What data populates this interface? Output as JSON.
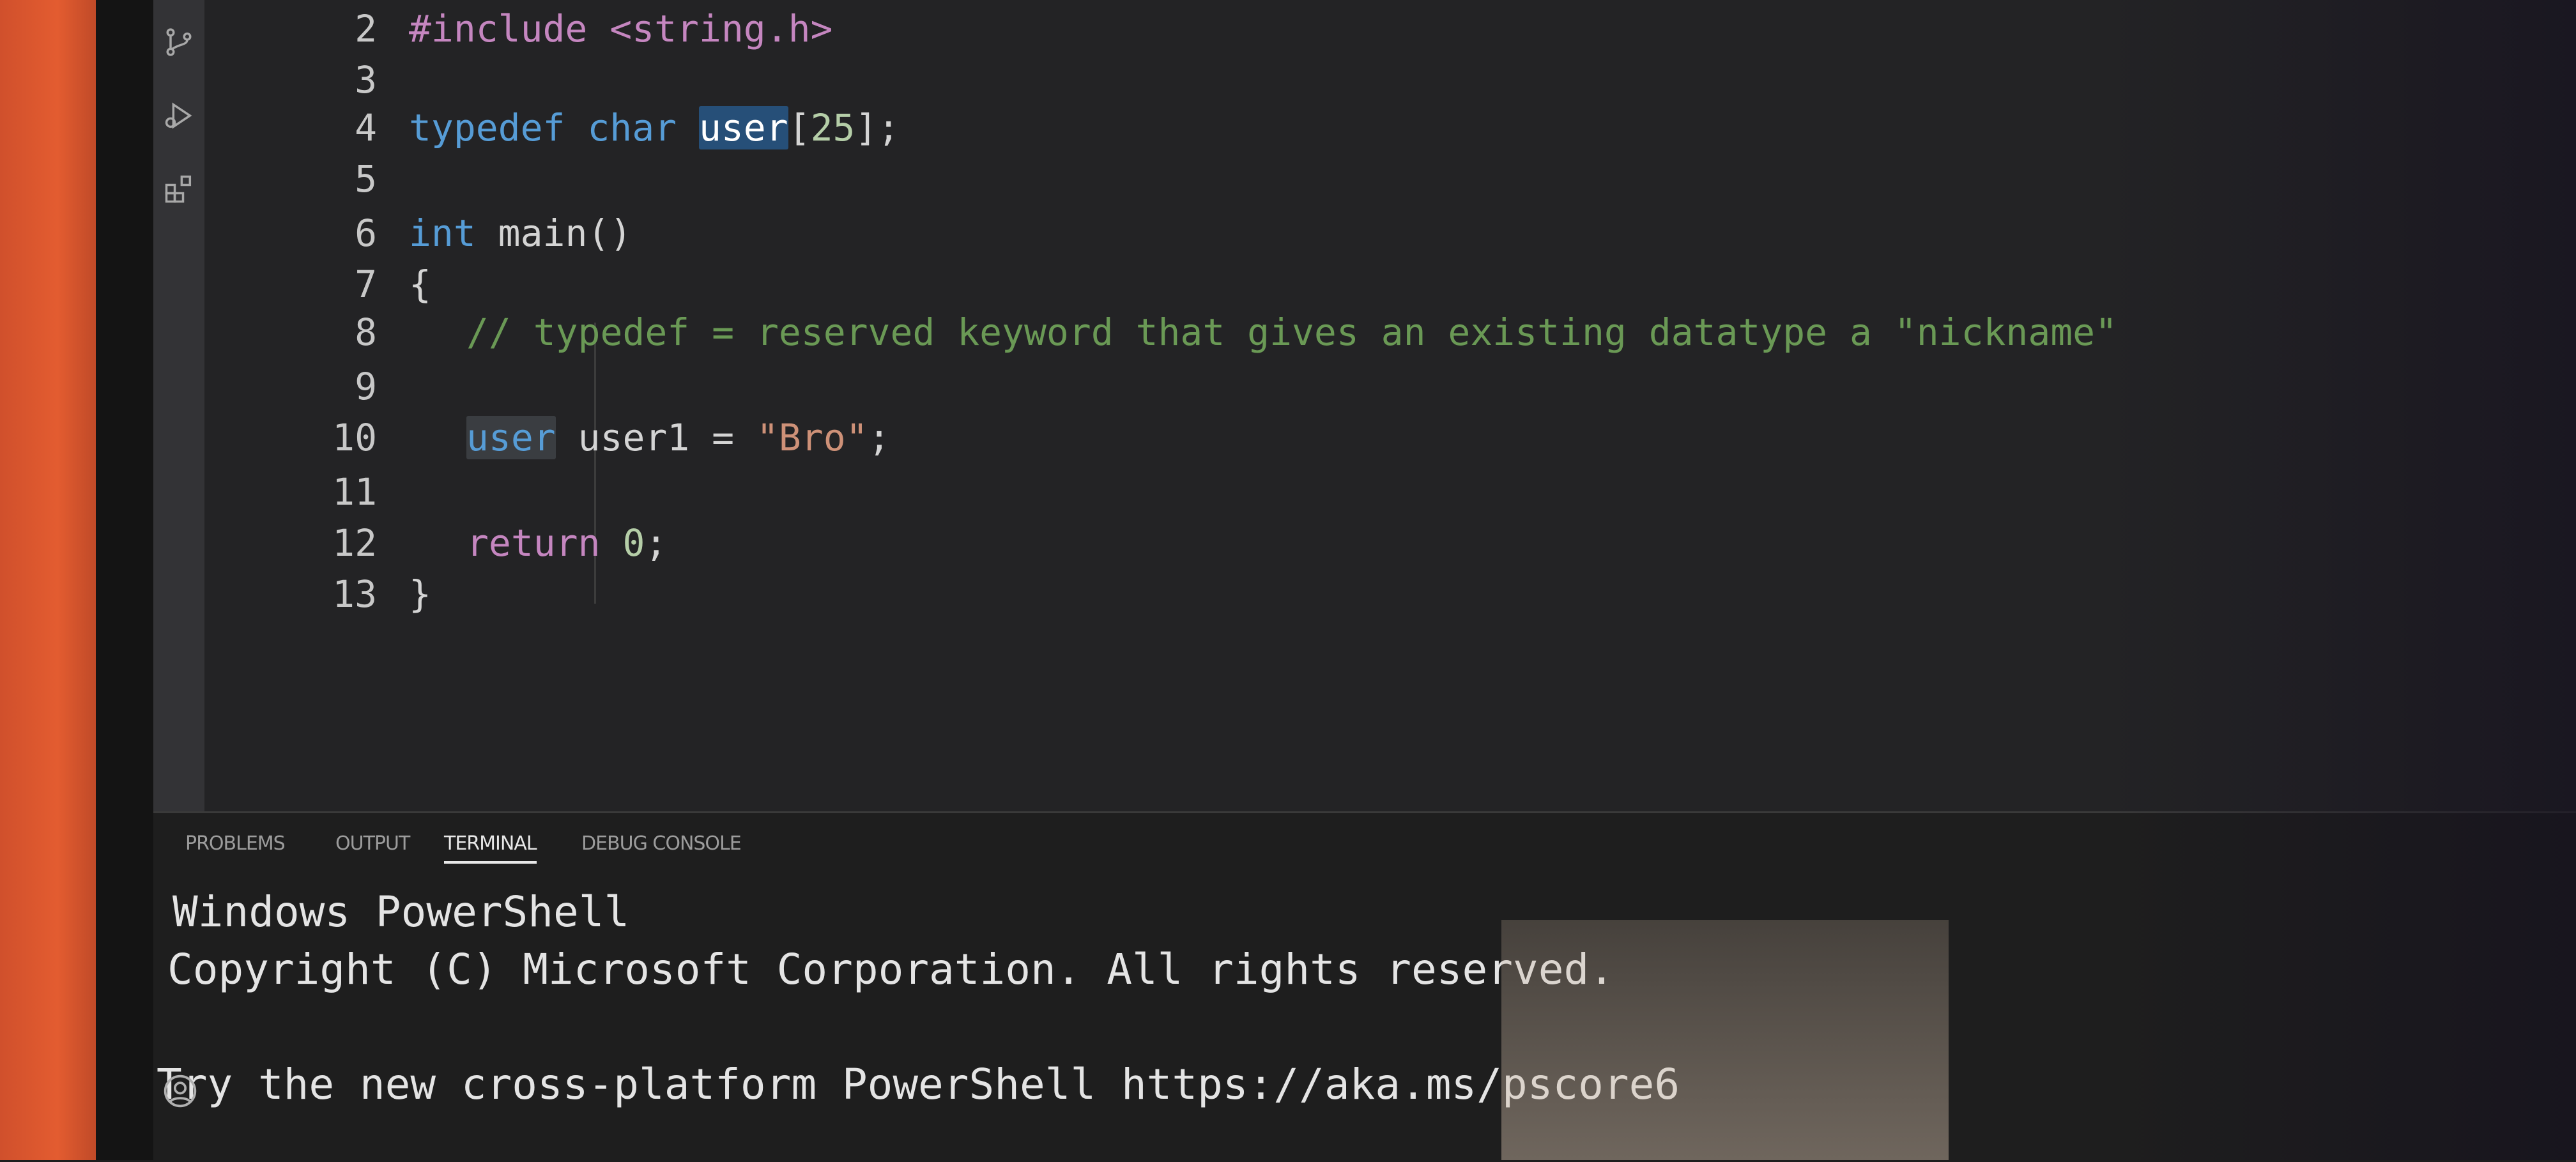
{
  "editor": {
    "lines": [
      {
        "n": "2",
        "tokens": [
          {
            "t": "#include <string.h>",
            "c": "kw-purple"
          }
        ]
      },
      {
        "n": "3",
        "tokens": []
      },
      {
        "n": "4",
        "tokens": [
          {
            "t": "typedef",
            "c": "kw-blue"
          },
          {
            "t": " "
          },
          {
            "t": "char",
            "c": "kw-blue"
          },
          {
            "t": " "
          },
          {
            "t": "user",
            "c": "hl"
          },
          {
            "t": "["
          },
          {
            "t": "25",
            "c": "num"
          },
          {
            "t": "];"
          }
        ]
      },
      {
        "n": "5",
        "tokens": []
      },
      {
        "n": "6",
        "tokens": [
          {
            "t": "int",
            "c": "kw-blue"
          },
          {
            "t": " main()"
          }
        ]
      },
      {
        "n": "7",
        "tokens": [
          {
            "t": "{"
          }
        ]
      },
      {
        "n": "8",
        "indent": true,
        "tokens": [
          {
            "t": "// typedef = reserved keyword that gives an existing datatype a \"nickname\"",
            "c": "cmt"
          }
        ]
      },
      {
        "n": "9",
        "tokens": []
      },
      {
        "n": "10",
        "indent": true,
        "tokens": [
          {
            "t": "user",
            "c": "hl2 kw-blue"
          },
          {
            "t": " user1 = "
          },
          {
            "t": "\"Bro\"",
            "c": "str"
          },
          {
            "t": ";"
          }
        ]
      },
      {
        "n": "11",
        "tokens": []
      },
      {
        "n": "12",
        "indent": true,
        "tokens": [
          {
            "t": "return",
            "c": "kw-purple"
          },
          {
            "t": " "
          },
          {
            "t": "0",
            "c": "num"
          },
          {
            "t": ";"
          }
        ]
      },
      {
        "n": "13",
        "tokens": [
          {
            "t": "}"
          }
        ]
      }
    ]
  },
  "panel": {
    "tabs": [
      "PROBLEMS",
      "OUTPUT",
      "TERMINAL",
      "DEBUG CONSOLE"
    ],
    "active_tab": "TERMINAL",
    "terminal_lines": [
      "Windows PowerShell",
      "Copyright (C) Microsoft Corporation. All rights reserved.",
      "",
      "Try the new cross-platform PowerShell https://aka.ms/pscore6"
    ]
  },
  "activity_bar": {
    "icons": [
      "source-control-icon",
      "run-debug-icon",
      "extensions-icon",
      "account-icon"
    ]
  },
  "colors": {
    "keyword": "#569cd6",
    "control": "#c586c0",
    "string": "#ce9178",
    "comment": "#6a9955",
    "highlight": "#264f78"
  }
}
